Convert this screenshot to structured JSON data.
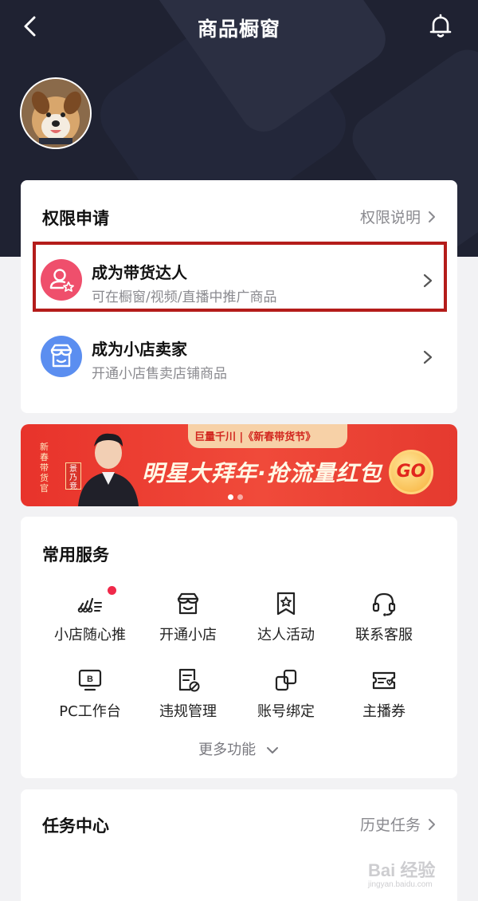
{
  "header": {
    "title": "商品橱窗"
  },
  "permission": {
    "title": "权限申请",
    "link_label": "权限说明",
    "items": [
      {
        "title": "成为带货达人",
        "subtitle": "可在橱窗/视频/直播中推广商品",
        "icon": "user-star-icon",
        "color": "#ef4f6c"
      },
      {
        "title": "成为小店卖家",
        "subtitle": "开通小店售卖店铺商品",
        "icon": "shop-icon",
        "color": "#5b8ef0"
      }
    ]
  },
  "banner": {
    "brand": "巨量千川 |《新春带货节》",
    "slogan": "明星大拜年·抢流量红包",
    "side_tag": "新春带货官",
    "name_tag": "景乃竞",
    "go_label": "GO",
    "page_count": 2,
    "active_page": 1
  },
  "services": {
    "title": "常用服务",
    "items": [
      {
        "label": "小店随心推",
        "icon": "promote-icon",
        "badge": true
      },
      {
        "label": "开通小店",
        "icon": "shop-icon"
      },
      {
        "label": "达人活动",
        "icon": "star-bookmark-icon"
      },
      {
        "label": "联系客服",
        "icon": "headset-icon"
      },
      {
        "label": "PC工作台",
        "icon": "monitor-icon"
      },
      {
        "label": "违规管理",
        "icon": "document-forbidden-icon"
      },
      {
        "label": "账号绑定",
        "icon": "link-icon"
      },
      {
        "label": "主播券",
        "icon": "coupon-icon"
      }
    ],
    "more_label": "更多功能"
  },
  "tasks": {
    "title": "任务中心",
    "link_label": "历史任务"
  },
  "watermark": {
    "text": "Bai 经验",
    "sub": "jingyan.baidu.com"
  },
  "colors": {
    "accent_red": "#b41c1a",
    "header_bg": "#1f2232",
    "badge_red": "#f0294a"
  }
}
